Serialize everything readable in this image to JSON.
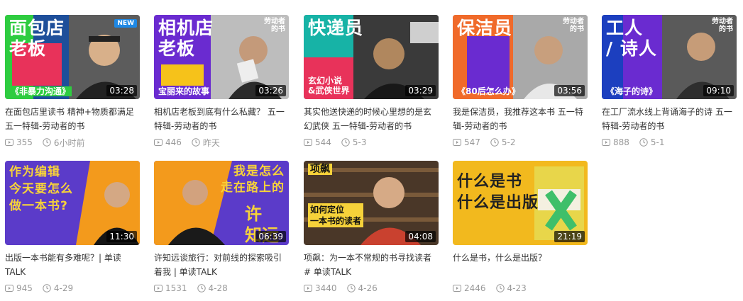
{
  "videos": [
    {
      "title": "在面包店里读书 精神+物质都满足 五一特辑-劳动者的书",
      "thumb_title": "面包店\n老板",
      "thumb_sub": "《非暴力沟通》",
      "badge": "",
      "tag": "NEW",
      "duration": "03:28",
      "views": "355",
      "date": "6小时前"
    },
    {
      "title": "相机店老板到底有什么私藏？ 五一特辑-劳动者的书",
      "thumb_title": "相机店\n老板",
      "thumb_sub": "宝丽来的故事",
      "badge": "劳动者\n的书",
      "tag": "",
      "duration": "03:26",
      "views": "446",
      "date": "昨天"
    },
    {
      "title": "其实他送快递的时候心里想的是玄幻武侠 五一特辑-劳动者的书",
      "thumb_title": "快递员",
      "thumb_sub": "玄幻小说\n&武侠世界",
      "badge": "",
      "tag": "",
      "duration": "03:29",
      "views": "544",
      "date": "5-3"
    },
    {
      "title": "我是保洁员，我推荐这本书 五一特辑-劳动者的书",
      "thumb_title": "保洁员",
      "thumb_sub": "《80后怎么办》",
      "badge": "劳动者\n的书",
      "tag": "",
      "duration": "03:56",
      "views": "547",
      "date": "5-2"
    },
    {
      "title": "在工厂流水线上背诵海子的诗 五一特辑-劳动者的书",
      "thumb_title": "工人\n/ 诗人",
      "thumb_sub": "《海子的诗》",
      "badge": "劳动者\n的书",
      "tag": "",
      "duration": "09:10",
      "views": "888",
      "date": "5-1"
    },
    {
      "title": "出版一本书能有多难呢？| 单读TALK",
      "thumb_title": "作为编辑\n今天要怎么\n做一本书?",
      "thumb_sub": "",
      "badge": "",
      "tag": "",
      "duration": "11:30",
      "views": "945",
      "date": "4-29"
    },
    {
      "title": "许知远谈旅行：对前线的探索吸引着我 | 单读TALK",
      "thumb_title": "我是怎么\n走在路上的",
      "thumb_sub": "许\n知远",
      "badge": "",
      "tag": "",
      "duration": "06:39",
      "views": "1531",
      "date": "4-28"
    },
    {
      "title": "项飙：为一本不常规的书寻找读者# 单读TALK",
      "thumb_title": "项飙",
      "thumb_sub": "如何定位\n一本书的读者",
      "badge": "",
      "tag": "",
      "duration": "04:08",
      "views": "3440",
      "date": "4-26"
    },
    {
      "title": "什么是书，什么是出版？",
      "thumb_title": "什么是书\n什么是出版",
      "thumb_sub": "",
      "badge": "",
      "tag": "",
      "duration": "21:19",
      "views": "2446",
      "date": "4-23"
    }
  ],
  "icons": {
    "views": "play-count-icon",
    "date": "clock-icon"
  },
  "colors": {
    "meta_text": "#999999",
    "title_text": "#333333",
    "orange": "#f39a1c",
    "purple": "#5b3bc9"
  }
}
